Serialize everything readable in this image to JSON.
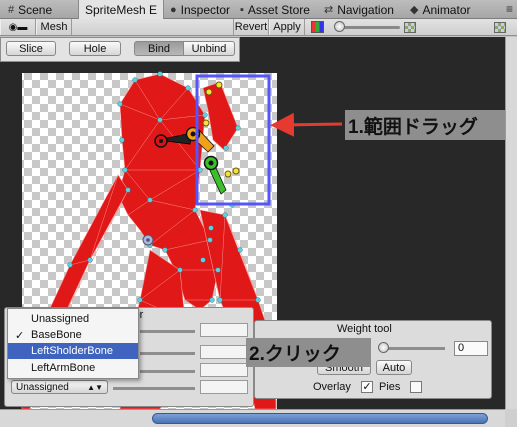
{
  "tabs": [
    {
      "label": "Scene",
      "icon": "grid-icon"
    },
    {
      "label": "SpriteMesh E",
      "icon": "mesh-icon"
    },
    {
      "label": "Inspector",
      "icon": "info-icon"
    },
    {
      "label": "Asset Store",
      "icon": "bag-icon"
    },
    {
      "label": "Navigation",
      "icon": "nav-icon"
    },
    {
      "label": "Animator",
      "icon": "animator-icon"
    }
  ],
  "toolbar": {
    "mesh_label": "Mesh",
    "revert_label": "Revert",
    "apply_label": "Apply"
  },
  "modes": {
    "slice": "Slice",
    "hole": "Hole",
    "bind": "Bind",
    "unbind": "Unbind",
    "active": "Bind"
  },
  "inspector": {
    "title_fragment": "ctor"
  },
  "bone_dropdown": {
    "options": [
      "Unassigned",
      "BaseBone",
      "LeftSholderBone",
      "LeftArmBone"
    ],
    "checked": "BaseBone",
    "highlighted": "LeftSholderBone",
    "button_value": "Unassigned"
  },
  "weight_tool": {
    "title": "Weight tool",
    "value": "0",
    "smooth_label": "Smooth",
    "auto_label": "Auto",
    "overlay_label": "Overlay",
    "overlay_checked": true,
    "pies_label": "Pies",
    "pies_checked": false
  },
  "annotations": {
    "step1": "1.範囲ドラッグ",
    "step2": "2.クリック"
  },
  "colors": {
    "mesh_fill": "#e01818",
    "vertex": "#5fd0e0",
    "selection": "#5555ff",
    "arrow": "#e53a2f",
    "highlight": "#3e64c0",
    "bone_selected": "#f2a01a",
    "bone_green": "#3bbf2b"
  }
}
